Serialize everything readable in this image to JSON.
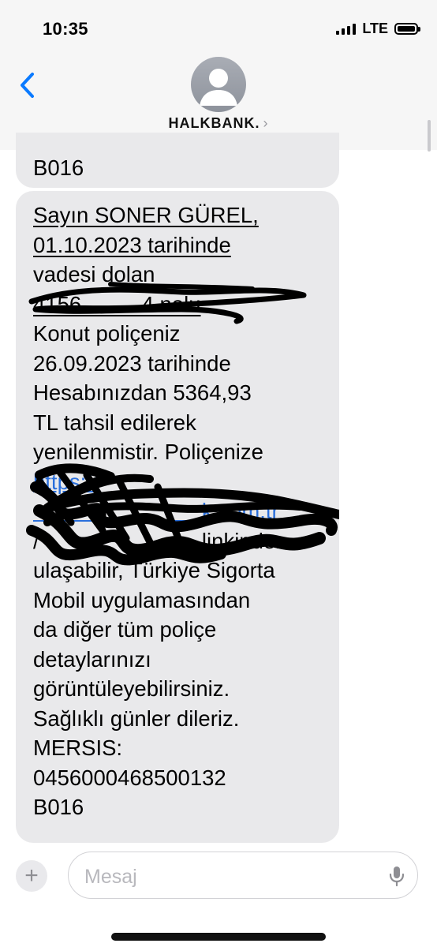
{
  "status_bar": {
    "time": "10:35",
    "network": "LTE"
  },
  "header": {
    "contact_name": "HALKBANK.",
    "chevron": "›"
  },
  "messages": [
    {
      "lines": [
        "B016"
      ]
    },
    {
      "lines": [
        "Sayın SONER GÜREL,",
        "01.10.2023 tarihinde",
        "vadesi dolan",
        "4156          4 nolu",
        "Konut poliçeniz",
        "26.09.2023 tarihinde",
        "Hesabınızdan 5364,93",
        "TL tahsil edilerek",
        "yenilenmistir. Poliçenize",
        "https://",
        "                            k.com.tr",
        "/                           linkinden",
        "ulaşabilir, Türkiye Sigorta",
        "Mobil uygulamasından",
        "da diğer tüm poliçe",
        "detaylarınızı",
        "görüntüleyebilirsiniz.",
        "Sağlıklı günler dileriz.",
        "MERSIS:",
        "0456000468500132",
        "B016"
      ]
    }
  ],
  "composer": {
    "placeholder": "Mesaj",
    "plus": "+"
  },
  "colors": {
    "header_bg": "#f6f6f6",
    "bubble_bg": "#e9e9eb",
    "accent": "#2a6fdc"
  },
  "icons": [
    "back-chevron-icon",
    "avatar-icon",
    "plus-icon",
    "microphone-icon",
    "signal-icon",
    "battery-icon"
  ]
}
